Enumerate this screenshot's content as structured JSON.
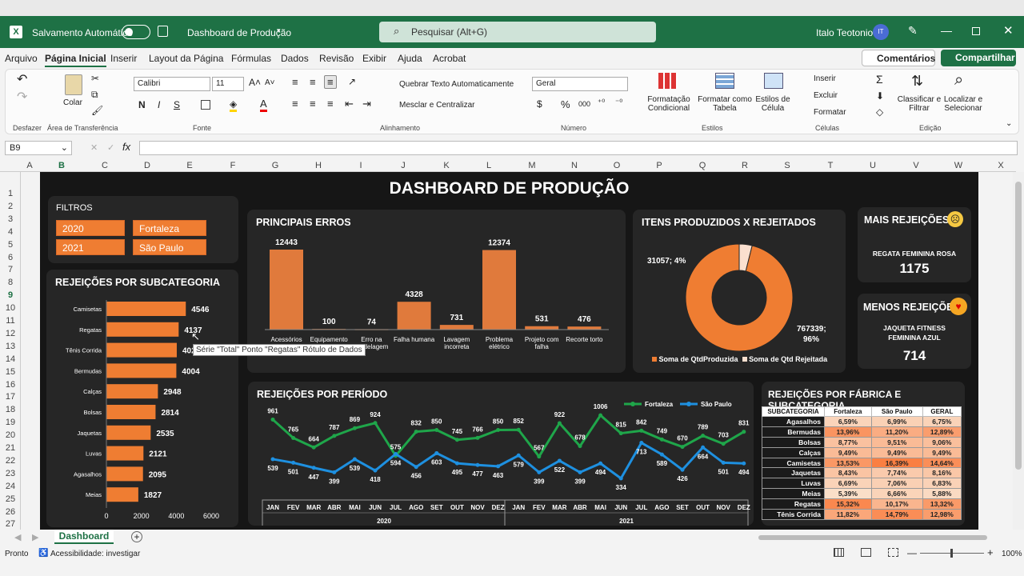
{
  "app": {
    "autosave": "Salvamento Automático",
    "doc": "Dashboard de Produção",
    "search": "Pesquisar (Alt+G)",
    "user": "Italo Teotonio",
    "initials": "IT"
  },
  "tabs": [
    "Arquivo",
    "Página Inicial",
    "Inserir",
    "Layout da Página",
    "Fórmulas",
    "Dados",
    "Revisão",
    "Exibir",
    "Ajuda",
    "Acrobat"
  ],
  "comments": "Comentários",
  "share": "Compartilhar",
  "ribbon": {
    "undo": "Desfazer",
    "clipboard": "Área de Transferência",
    "paste": "Colar",
    "font_name": "Calibri",
    "font_size": "11",
    "font_group": "Fonte",
    "wrap": "Quebrar Texto Automaticamente",
    "merge": "Mesclar e Centralizar",
    "align_group": "Alinhamento",
    "num_format": "Geral",
    "num_group": "Número",
    "cond": "Formatação Condicional",
    "table": "Formatar como Tabela",
    "styles": "Estilos de Célula",
    "styles_group": "Estilos",
    "insert": "Inserir",
    "delete": "Excluir",
    "format": "Formatar",
    "cells_group": "Células",
    "sort": "Classificar e Filtrar",
    "find": "Localizar e Selecionar",
    "edit_group": "Edição"
  },
  "namebox": "B9",
  "cols": [
    "A",
    "B",
    "C",
    "D",
    "E",
    "F",
    "G",
    "H",
    "I",
    "J",
    "K",
    "L",
    "M",
    "N",
    "O",
    "P",
    "Q",
    "R",
    "S",
    "T",
    "U",
    "V",
    "W",
    "X"
  ],
  "rows": [
    "1",
    "2",
    "3",
    "4",
    "5",
    "6",
    "7",
    "8",
    "9",
    "10",
    "11",
    "12",
    "13",
    "14",
    "15",
    "16",
    "17",
    "18",
    "19",
    "20",
    "21",
    "22",
    "23",
    "24",
    "25",
    "26",
    "27"
  ],
  "dash": {
    "title": "DASHBOARD DE PRODUÇÃO",
    "filters": "FILTROS",
    "f2020": "2020",
    "f2021": "2021",
    "fFor": "Fortaleza",
    "fSP": "São Paulo",
    "sub_title": "REJEIÇÕES POR SUBCATEGORIA",
    "err_title": "PRINCIPAIS ERROS",
    "donut_title": "ITENS PRODUZIDOS X REJEITADOS",
    "donut_l1": "31057; 4%",
    "donut_l2a": "767339;",
    "donut_l2b": "96%",
    "donut_leg1": "Soma de QtdProduzida",
    "donut_leg2": "Soma de Qtd Rejeitada",
    "most_title": "MAIS REJEIÇÕES",
    "most_item": "REGATA FEMININA ROSA",
    "most_val": "1175",
    "least_title": "MENOS REJEIÇÕES",
    "least_item1": "JAQUETA FITNESS",
    "least_item2": "FEMININA AZUL",
    "least_val": "714",
    "period_title": "REJEIÇÕES POR PERÍODO",
    "fab_title": "REJEIÇÕES POR FÁBRICA E SUBCATEGORIA",
    "tooltip": "Série \"Total\" Ponto \"Regatas\" Rótulo de Dados",
    "table": {
      "headers": [
        "SUBCATEGORIA",
        "Fortaleza",
        "São Paulo",
        "GERAL"
      ],
      "rows": [
        [
          "Agasalhos",
          "6,59%",
          "6,99%",
          "6,75%"
        ],
        [
          "Bermudas",
          "13,96%",
          "11,20%",
          "12,89%"
        ],
        [
          "Bolsas",
          "8,77%",
          "9,51%",
          "9,06%"
        ],
        [
          "Calças",
          "9,49%",
          "9,49%",
          "9,49%"
        ],
        [
          "Camisetas",
          "13,53%",
          "16,39%",
          "14,64%"
        ],
        [
          "Jaquetas",
          "8,43%",
          "7,74%",
          "8,16%"
        ],
        [
          "Luvas",
          "6,69%",
          "7,06%",
          "6,83%"
        ],
        [
          "Meias",
          "5,39%",
          "6,66%",
          "5,88%"
        ],
        [
          "Regatas",
          "15,32%",
          "10,17%",
          "13,32%"
        ],
        [
          "Tênis Corrida",
          "11,82%",
          "14,79%",
          "12,98%"
        ]
      ]
    }
  },
  "sheet_tab": "Dashboard",
  "status": {
    "ready": "Pronto",
    "acc": "Acessibilidade: investigar",
    "zoom": "100%"
  },
  "chart_data": [
    {
      "type": "bar",
      "title": "REJEIÇÕES POR SUBCATEGORIA",
      "categories": [
        "Camisetas",
        "Regatas",
        "Tênis Corrida",
        "Bermudas",
        "Calças",
        "Bolsas",
        "Jaquetas",
        "Luvas",
        "Agasalhos",
        "Meias"
      ],
      "values": [
        4546,
        4137,
        4029,
        4004,
        2948,
        2814,
        2535,
        2121,
        2095,
        1827
      ],
      "xlim": [
        0,
        6000
      ],
      "xticks": [
        "0",
        "2000",
        "4000",
        "6000"
      ],
      "color": "#ef7d32"
    },
    {
      "type": "bar",
      "title": "PRINCIPAIS ERROS",
      "categories": [
        "Acessórios",
        "Equipamento",
        "Erro na modelagem",
        "Falha humana",
        "Lavagem incorreta",
        "Problema elétrico",
        "Projeto com falha",
        "Recorte torto"
      ],
      "values": [
        12443,
        100,
        74,
        4328,
        731,
        12374,
        531,
        476
      ],
      "color": "#e07a3c"
    },
    {
      "type": "pie",
      "title": "ITENS PRODUZIDOS X REJEITADOS",
      "labels": [
        "Soma de QtdProduzida",
        "Soma de Qtd Rejeitada"
      ],
      "values": [
        767339,
        31057
      ],
      "colors": [
        "#ef7d32",
        "#fbe0cf"
      ]
    },
    {
      "type": "line",
      "title": "REJEIÇÕES POR PERÍODO",
      "x": [
        "JAN",
        "FEV",
        "MAR",
        "ABR",
        "MAI",
        "JUN",
        "JUL",
        "AGO",
        "SET",
        "OUT",
        "NOV",
        "DEZ",
        "JAN",
        "FEV",
        "MAR",
        "ABR",
        "MAI",
        "JUN",
        "JUL",
        "AGO",
        "SET",
        "OUT",
        "NOV",
        "DEZ"
      ],
      "years": [
        "2020",
        "2021"
      ],
      "series": [
        {
          "name": "Fortaleza",
          "color": "#1fa64a",
          "values": [
            961,
            765,
            664,
            787,
            869,
            924,
            575,
            832,
            850,
            745,
            766,
            850,
            852,
            567,
            922,
            678,
            1006,
            815,
            842,
            749,
            670,
            789,
            703,
            831
          ]
        },
        {
          "name": "São Paulo",
          "color": "#1e90e0",
          "values": [
            539,
            501,
            447,
            399,
            539,
            418,
            594,
            456,
            603,
            495,
            477,
            463,
            579,
            399,
            522,
            399,
            494,
            334,
            713,
            589,
            426,
            664,
            501,
            494
          ]
        }
      ]
    }
  ]
}
